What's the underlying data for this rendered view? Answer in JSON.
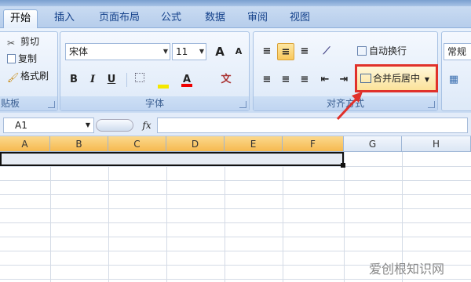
{
  "tabs": [
    "开始",
    "插入",
    "页面布局",
    "公式",
    "数据",
    "审阅",
    "视图"
  ],
  "clipboard": {
    "cut": "剪切",
    "copy": "复制",
    "format_painter": "格式刷",
    "group_label": "贴板"
  },
  "font": {
    "name": "宋体",
    "size": "11",
    "grow": "A",
    "shrink": "A",
    "bold": "B",
    "italic": "I",
    "underline": "U",
    "group_label": "字体"
  },
  "alignment": {
    "wrap_text": "自动换行",
    "merge_center": "合并后居中",
    "group_label": "对齐方式"
  },
  "number": {
    "format": "常规"
  },
  "formula_bar": {
    "cell_ref": "A1",
    "fx": "fx"
  },
  "columns": [
    "A",
    "B",
    "C",
    "D",
    "E",
    "F",
    "G",
    "H"
  ],
  "watermark": "爱创根知识网",
  "colors": {
    "highlight_border": "#e0312b",
    "arrow": "#e0312b",
    "selected_header": "#f6b94f"
  }
}
